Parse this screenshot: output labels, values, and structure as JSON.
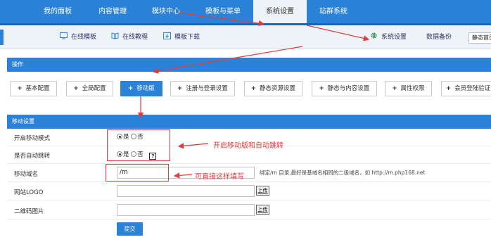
{
  "topnav": {
    "items": [
      {
        "label": "我的面板"
      },
      {
        "label": "内容管理"
      },
      {
        "label": "模块中心"
      },
      {
        "label": "模板与菜单"
      },
      {
        "label": "系统设置"
      },
      {
        "label": "站群系统"
      }
    ],
    "active": "系统设置"
  },
  "subnav": {
    "links": [
      {
        "label": "在线模板",
        "icon": "monitor-icon"
      },
      {
        "label": "在线教程",
        "icon": "book-icon"
      },
      {
        "label": "模板下载",
        "icon": "download-icon"
      }
    ],
    "right": [
      {
        "label": "系统设置",
        "icon": "gear-icon"
      },
      {
        "label": "数据备份"
      }
    ],
    "static_button": "静态首页"
  },
  "ops": {
    "title": "操作",
    "buttons": [
      {
        "label": "基本配置"
      },
      {
        "label": "全局配置"
      },
      {
        "label": "移动版"
      },
      {
        "label": "注册与登录设置"
      },
      {
        "label": "静态资源设置"
      },
      {
        "label": "静态与内容设置"
      },
      {
        "label": "属性权限"
      },
      {
        "label": "会员登陆验证"
      }
    ],
    "active": "移动版"
  },
  "mobile": {
    "title": "移动设置",
    "rows": {
      "enable": {
        "label": "开启移动模式",
        "yes": "是",
        "no": "否",
        "value": "是"
      },
      "auto": {
        "label": "是否自动跳转",
        "yes": "是",
        "no": "否",
        "value": "是",
        "help": "?"
      },
      "domain": {
        "label": "移动域名",
        "value": "/m",
        "hint": "绑定/m 目录,最好是基域名相同的二级域名，如 http://m.php168.net"
      },
      "logo": {
        "label": "网站LOGO",
        "value": "",
        "upload": "上传"
      },
      "qrcode": {
        "label": "二维码图片",
        "value": "",
        "upload": "上传"
      }
    },
    "submit": "提交"
  },
  "annotations": {
    "note1": "开启移动版和自动跳转",
    "note2": "可直接这样填写",
    "color": "#e23b3b"
  },
  "colors": {
    "primary": "#2c82d6",
    "subnav_bg": "#eef3f8"
  }
}
